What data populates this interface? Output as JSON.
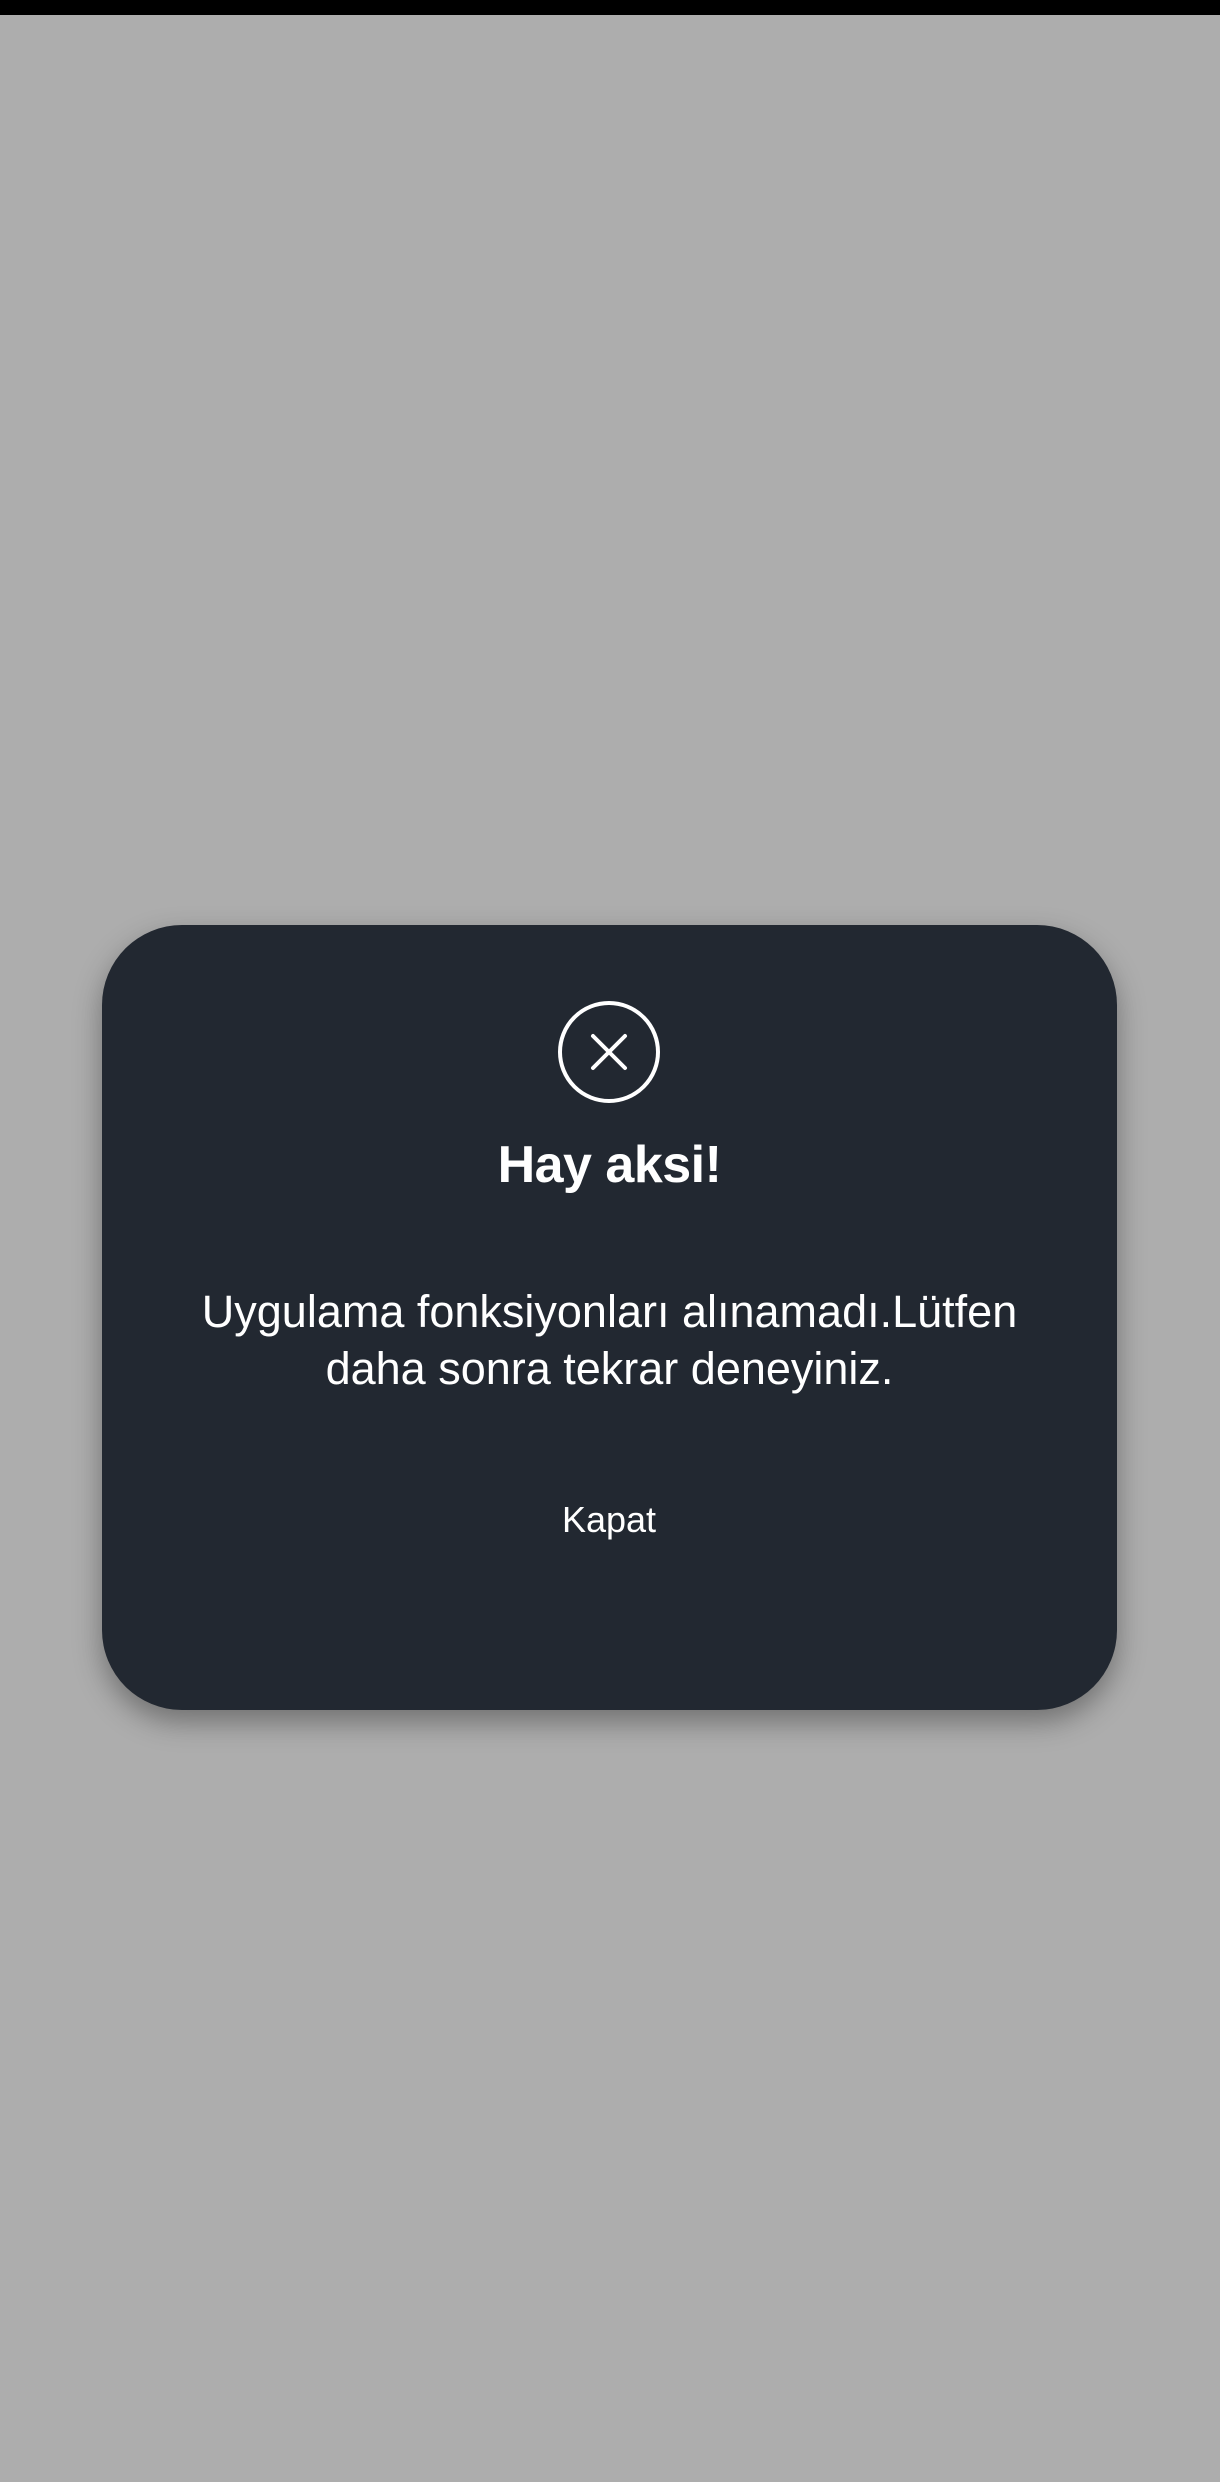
{
  "dialog": {
    "title": "Hay aksi!",
    "message": "Uygulama fonksiyonları alınamadı.Lütfen daha sonra tekrar deneyiniz.",
    "close_label": "Kapat",
    "icon": "close-circle-icon"
  },
  "colors": {
    "background": "#adadad",
    "dialog": "#222831",
    "text": "#ffffff",
    "status_bar": "#000000"
  }
}
